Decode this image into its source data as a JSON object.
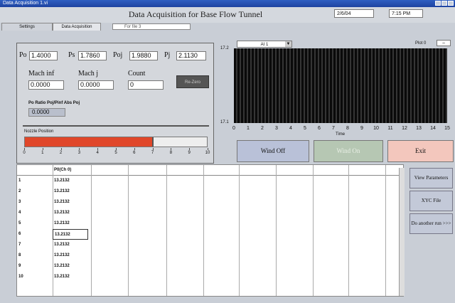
{
  "window": {
    "title": "Data Acquisition 1.vi"
  },
  "header": {
    "title": "Data Acquisition for Base Flow Tunnel",
    "date": "2/6/04",
    "time": "7:15 PM"
  },
  "tabs": [
    {
      "label": "Settings"
    },
    {
      "label": "Data Acquisition"
    }
  ],
  "tab_field": {
    "value": "For file 3"
  },
  "params": {
    "po": {
      "label": "Po",
      "value": "1.4000"
    },
    "ps": {
      "label": "Ps",
      "value": "1.7860"
    },
    "poj": {
      "label": "Poj",
      "value": "1.9880"
    },
    "pj": {
      "label": "Pj",
      "value": "2.1130"
    },
    "mach_inf": {
      "label": "Mach inf",
      "value": "0.0000"
    },
    "mach_j": {
      "label": "Mach j",
      "value": "0.0000"
    },
    "count": {
      "label": "Count",
      "value": "0"
    },
    "rezero_label": "Re-Zero",
    "ratio": {
      "label": "Po Ratio Poj/Pinf Abs Poj",
      "value": "0.0000"
    }
  },
  "nozzle": {
    "label": "Nozzle Position",
    "value": 7,
    "max": 10,
    "ticks": [
      "0",
      "1",
      "2",
      "3",
      "4",
      "5",
      "6",
      "7",
      "8",
      "9",
      "10"
    ]
  },
  "chart": {
    "dropdown_value": "AI 1",
    "plot_label": "Plot 0",
    "plot_icon": "line-icon",
    "ymax_label": "17.2",
    "ymin_label": "17.1",
    "xlabel": "Time",
    "xticks": [
      "0",
      "1",
      "2",
      "3",
      "4",
      "5",
      "6",
      "7",
      "8",
      "9",
      "10",
      "11",
      "12",
      "13",
      "14",
      "15"
    ]
  },
  "buttons": {
    "wind_off": "Wind Off",
    "wind_on": "Wind On",
    "exit": "Exit"
  },
  "colors": {
    "wind_off": "#b9c1d8",
    "wind_on": "#b6c7b3",
    "exit": "#f3c7bd",
    "nozzle_fill": "#e0472a"
  },
  "table": {
    "header": [
      "",
      "P0(Ch 0)",
      "",
      "",
      "",
      "",
      "",
      "",
      "",
      ""
    ],
    "rows": [
      [
        "1",
        "13.2132"
      ],
      [
        "2",
        "13.2132"
      ],
      [
        "3",
        "13.2132"
      ],
      [
        "4",
        "13.2132"
      ],
      [
        "5",
        "13.2132"
      ],
      [
        "6",
        "13.2132"
      ],
      [
        "7",
        "13.2132"
      ],
      [
        "8",
        "13.2132"
      ],
      [
        "9",
        "13.2132"
      ],
      [
        "10",
        "13.2132"
      ]
    ]
  },
  "side_buttons": {
    "view": "View Parameters",
    "file": "XYC File",
    "another": "Do another run >>>"
  }
}
